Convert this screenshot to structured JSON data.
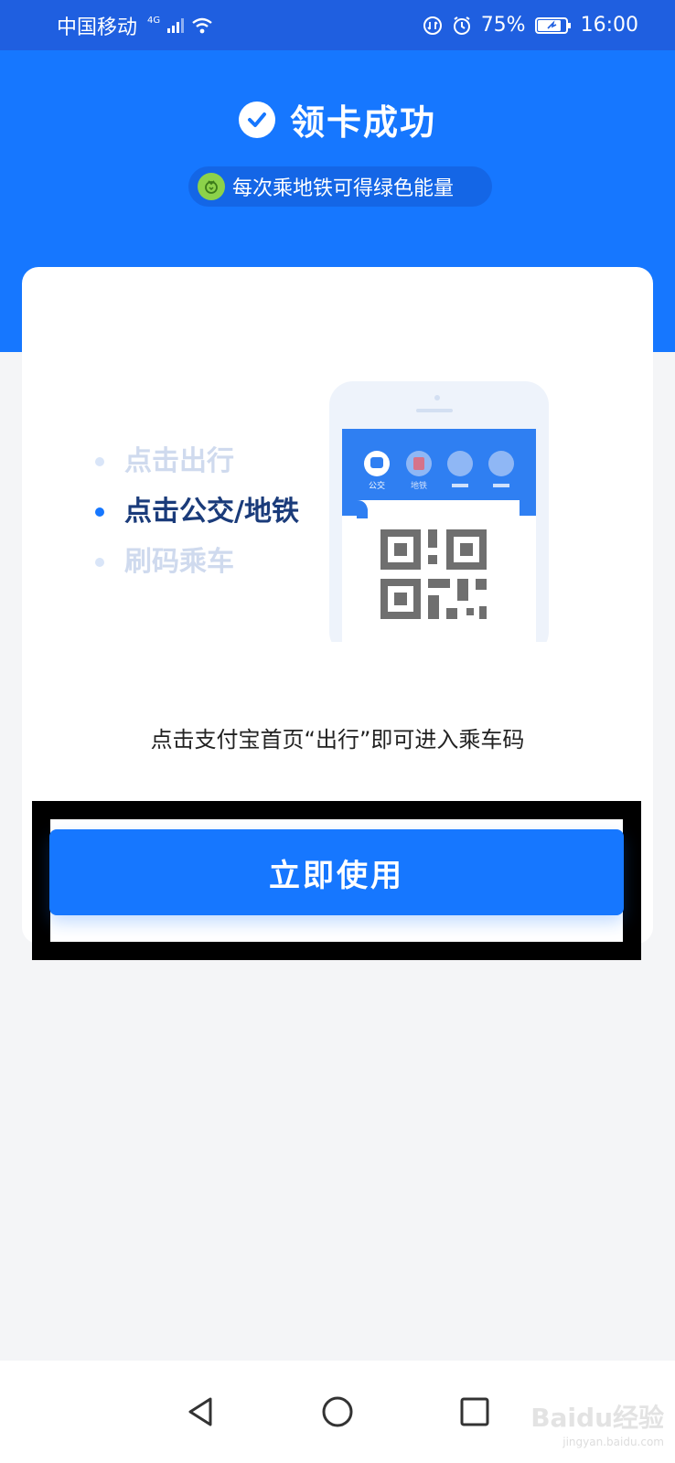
{
  "status_bar": {
    "carrier": "中国移动",
    "network": "4G",
    "battery": "75%",
    "time": "16:00"
  },
  "header": {
    "title": "领卡成功",
    "energy_tip": "每次乘地铁可得绿色能量"
  },
  "card": {
    "steps": [
      {
        "label": "点击出行",
        "active": false
      },
      {
        "label": "点击公交/地铁",
        "active": true
      },
      {
        "label": "刷码乘车",
        "active": false
      }
    ],
    "phone_tabs": [
      "公交",
      "地铁"
    ],
    "instruction": "点击支付宝首页“出行”即可进入乘车码"
  },
  "actions": {
    "use_now": "立即使用"
  },
  "watermark": {
    "brand": "Baidu经验",
    "url": "jingyan.baidu.com"
  },
  "colors": {
    "primary": "#1677ff",
    "status_bar": "#1f5fe0",
    "background": "#f4f5f7",
    "energy_green": "#8cd24a",
    "highlight_border": "#000000"
  }
}
